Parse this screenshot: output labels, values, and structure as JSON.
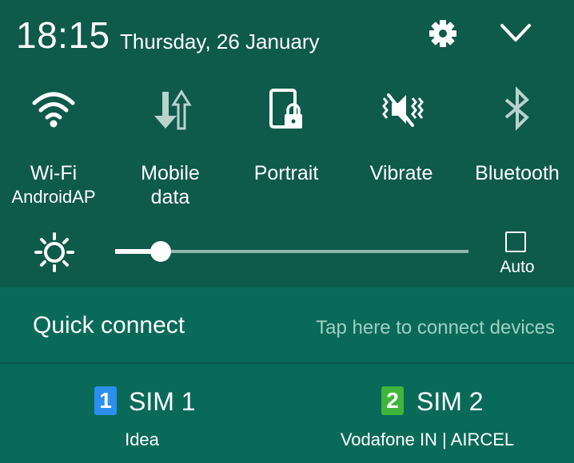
{
  "status": {
    "time": "18:15",
    "date": "Thursday, 26 January"
  },
  "header_icons": {
    "settings": "gear-icon",
    "collapse": "chevron-down-icon"
  },
  "tiles": [
    {
      "icon": "wifi-icon",
      "label": "Wi-Fi",
      "sub": "AndroidAP"
    },
    {
      "icon": "mobile-data-icon",
      "label": "Mobile",
      "sub": "data"
    },
    {
      "icon": "portrait-lock-icon",
      "label": "Portrait",
      "sub": ""
    },
    {
      "icon": "vibrate-icon",
      "label": "Vibrate",
      "sub": ""
    },
    {
      "icon": "bluetooth-icon",
      "label": "Bluetooth",
      "sub": ""
    }
  ],
  "brightness": {
    "level": 0.13,
    "auto_label": "Auto",
    "auto_checked": false
  },
  "quick_connect": {
    "title": "Quick connect",
    "hint": "Tap here to connect devices"
  },
  "sims": [
    {
      "badge": "1",
      "name": "SIM 1",
      "carrier": "Idea",
      "color": "#2b8ff0"
    },
    {
      "badge": "2",
      "name": "SIM 2",
      "carrier": "Vodafone IN | AIRCEL",
      "color": "#3fb53c"
    }
  ],
  "colors": {
    "panel": "#0e5a4b",
    "quick_connect_bg": "#0a6a5a",
    "hint_text": "#9fcfc3"
  }
}
